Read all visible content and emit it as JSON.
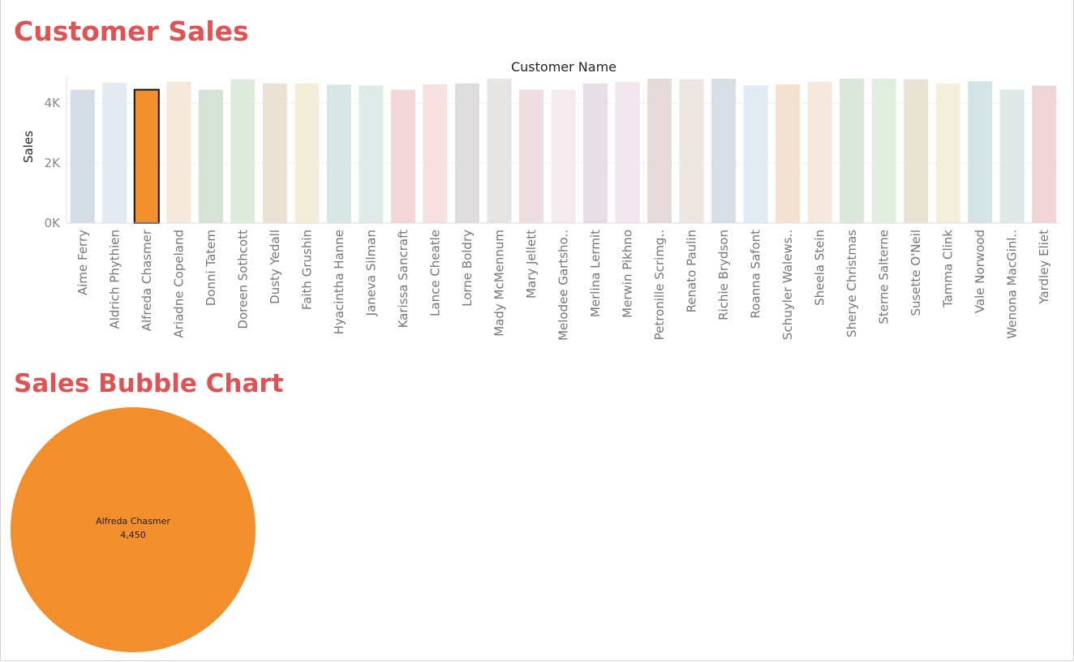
{
  "dashboard": {
    "title1": "Customer Sales",
    "title2": "Sales Bubble Chart"
  },
  "chart_data": [
    {
      "type": "bar",
      "xlabel": "Customer Name",
      "ylabel": "Sales",
      "ylim": [
        0,
        4900
      ],
      "yticks": [
        0,
        2000,
        4000
      ],
      "ytick_labels": [
        "0K",
        "2K",
        "4K"
      ],
      "x_axis_position": "top",
      "highlighted_category": "Alfreda Chasmer",
      "highlight_color": "#f28e2b",
      "categories": [
        "Aime Ferry",
        "Aldrich Phythien",
        "Alfreda Chasmer",
        "Ariadne Copeland",
        "Donni Tatem",
        "Doreen Sothcott",
        "Dusty Yedall",
        "Faith Grushin",
        "Hyacintha Hanne",
        "Janeva Silman",
        "Karissa Sancraft",
        "Lance Cheatle",
        "Lorne Boldry",
        "Mady McMennum",
        "Mary Jellett",
        "Melodee Gartsho..",
        "Merlina Lermit",
        "Merwin Pikhno",
        "Petronille Scrimg..",
        "Renato Paulin",
        "Richie Brydson",
        "Roanna Safont",
        "Schuyler Walews..",
        "Sheela Stein",
        "Sherye Christmas",
        "Sterne Salterne",
        "Susette O'Neil",
        "Tamma Clink",
        "Vale Norwood",
        "Wenona MacGinl..",
        "Yardley Eliet"
      ],
      "values": [
        4450,
        4680,
        4450,
        4720,
        4450,
        4800,
        4660,
        4660,
        4620,
        4590,
        4450,
        4630,
        4660,
        4820,
        4450,
        4450,
        4660,
        4700,
        4820,
        4800,
        4820,
        4590,
        4630,
        4720,
        4820,
        4820,
        4800,
        4660,
        4740,
        4450,
        4590
      ],
      "colors": [
        "#d4dde5",
        "#e3eaf1",
        "#f28e2b",
        "#f5e8db",
        "#d6e2d6",
        "#deecde",
        "#eae3d3",
        "#f3eeda",
        "#d8e7e6",
        "#deebe8",
        "#f2d6d8",
        "#f6e0e2",
        "#dfdcdc",
        "#e6e5e3",
        "#eedde1",
        "#f6eaee",
        "#e7dde4",
        "#f1e6ee",
        "#e6dbda",
        "#ede6e2",
        "#d7dee5",
        "#e2eaf3",
        "#f4e2d0",
        "#f5e8dc",
        "#dae7da",
        "#e1efe1",
        "#e8e3d3",
        "#f4efdb",
        "#d5e4e4",
        "#dfe9e7",
        "#f0d4d7"
      ],
      "grid": true,
      "legend": "none"
    },
    {
      "type": "bubble",
      "bubbles": [
        {
          "name": "Alfreda Chasmer",
          "label": "Alfreda Chasmer",
          "value": 4450,
          "value_label": "4,450",
          "color": "#f28e2b"
        }
      ]
    }
  ]
}
